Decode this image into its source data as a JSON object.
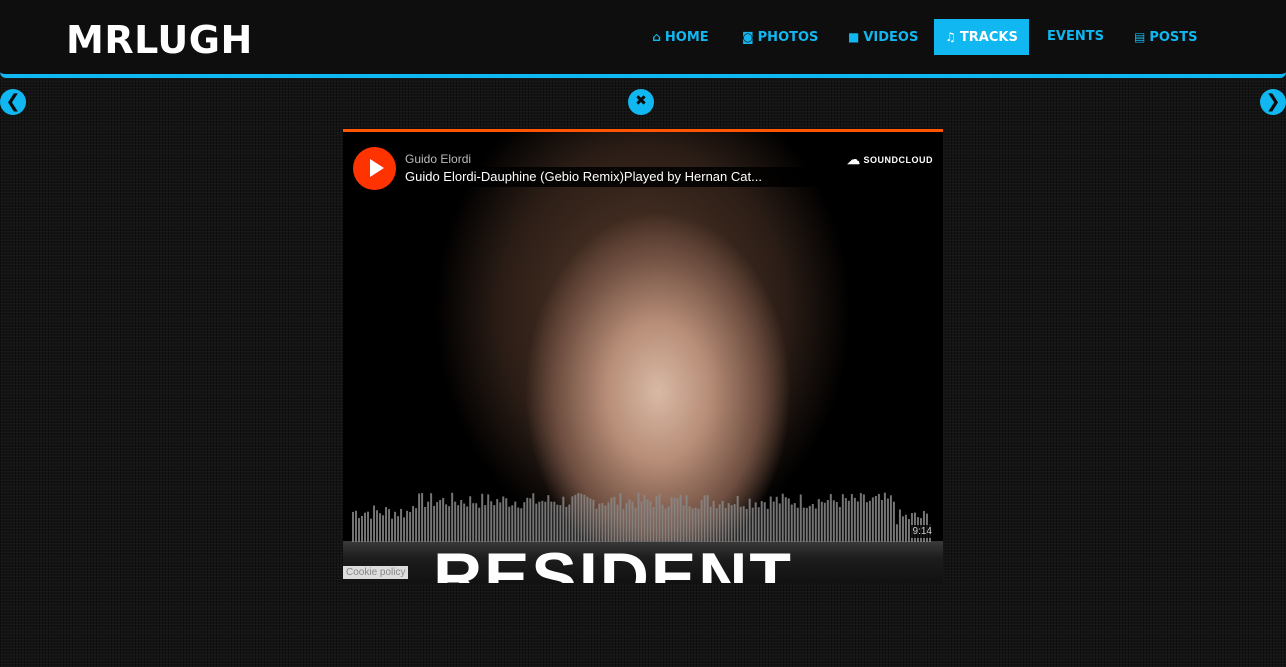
{
  "brand": "MRLUGH",
  "nav": [
    {
      "label": "HOME",
      "icon": "home-icon",
      "glyph": "⌂"
    },
    {
      "label": "PHOTOS",
      "icon": "camera-icon",
      "glyph": "◙"
    },
    {
      "label": "VIDEOS",
      "icon": "video-camera-icon",
      "glyph": "■"
    },
    {
      "label": "TRACKS",
      "icon": "music-note-icon",
      "glyph": "♫",
      "active": true
    },
    {
      "label": "EVENTS",
      "icon": "",
      "glyph": ""
    },
    {
      "label": "POSTS",
      "icon": "file-text-icon",
      "glyph": "▤"
    }
  ],
  "controls": {
    "prev_glyph": "❮",
    "close_glyph": "✖",
    "next_glyph": "❯"
  },
  "player": {
    "artist": "Guido Elordi",
    "title": "Guido Elordi-Dauphine (Gebio Remix)Played by Hernan Cat...",
    "logo": "SOUNDCLOUD",
    "duration": "9:14",
    "artwork_text": "RESIDENT",
    "cookie": "Cookie policy"
  },
  "colors": {
    "accent": "#11b7f0",
    "soundcloud_orange": "#ff5500",
    "background": "#141414"
  }
}
